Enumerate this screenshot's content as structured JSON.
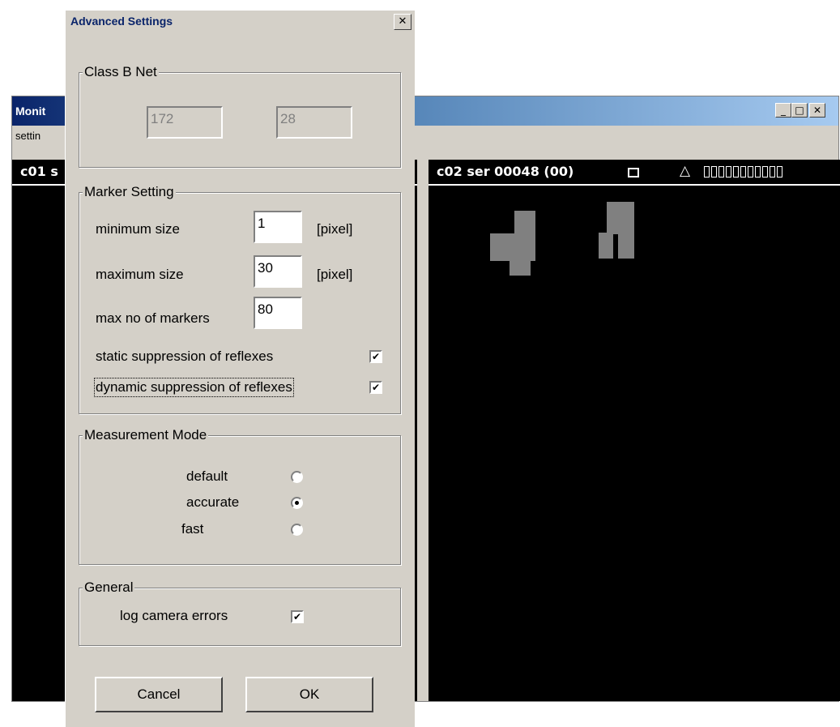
{
  "monitor": {
    "title": "Monit",
    "menu_item": "settin",
    "left_pane_label": "c01 s",
    "right_pane_label": "c02 ser 00048 (00)",
    "triangle_symbol": "△",
    "minimize_glyph": "_",
    "maximize_glyph": "□",
    "close_glyph": "✕"
  },
  "dialog": {
    "title": "Advanced Settings",
    "close_glyph": "✕",
    "class_b_net": {
      "legend": "Class B Net",
      "field1": "172",
      "field2": "28"
    },
    "marker_setting": {
      "legend": "Marker Setting",
      "min_label": "minimum size",
      "min_value": "1",
      "min_unit": "[pixel]",
      "max_label": "maximum size",
      "max_value": "30",
      "max_unit": "[pixel]",
      "markers_label": "max no of markers",
      "markers_value": "80",
      "static_label": "static suppression of reflexes",
      "static_checked": true,
      "dynamic_label": "dynamic suppression of reflexes",
      "dynamic_checked": true
    },
    "measurement_mode": {
      "legend": "Measurement Mode",
      "options": [
        "default",
        "accurate",
        "fast"
      ],
      "selected": "accurate"
    },
    "general": {
      "legend": "General",
      "log_label": "log camera errors",
      "log_checked": true
    },
    "buttons": {
      "cancel": "Cancel",
      "ok": "OK"
    },
    "check_glyph": "✔"
  }
}
